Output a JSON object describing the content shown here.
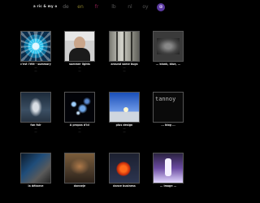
{
  "header": {
    "site_title": "a ric & my o"
  },
  "languages": [
    {
      "code": "de"
    },
    {
      "code": "en"
    },
    {
      "code": "fr"
    },
    {
      "code": "lb"
    },
    {
      "code": "nl"
    },
    {
      "code": "oy"
    },
    {
      "code": "⊕",
      "active": true
    }
  ],
  "tiles": [
    {
      "title": "c'est l'été - summary",
      "sub1": "...",
      "sub2": "..."
    },
    {
      "title": "summer lights",
      "sub1": "...",
      "sub2": "..."
    },
    {
      "title": "around some bugs",
      "sub1": "...",
      "sub2": "..."
    },
    {
      "title": "... blank, blue, ...",
      "sub1": "",
      "sub2": ""
    },
    {
      "title": "fun fair",
      "sub1": "...",
      "sub2": "..."
    },
    {
      "title": "A propos d'ici",
      "sub1": "...",
      "sub2": "..."
    },
    {
      "title": "plus design",
      "sub1": "...",
      "sub2": "..."
    },
    {
      "title": "... blog ...",
      "sub1": "",
      "sub2": ""
    },
    {
      "title": "la déborce",
      "sub1": "",
      "sub2": ""
    },
    {
      "title": "donneje",
      "sub1": "",
      "sub2": ""
    },
    {
      "title": "dance business",
      "sub1": "",
      "sub2": ""
    },
    {
      "title": "... image ...",
      "sub1": "",
      "sub2": ""
    }
  ],
  "tile_8_overlay": "tannoy",
  "colors": {
    "background": "#000000",
    "active_lang": "#5b3aa0",
    "lang_en": "#8a7f2a",
    "lang_fr": "#8a1d4e"
  }
}
